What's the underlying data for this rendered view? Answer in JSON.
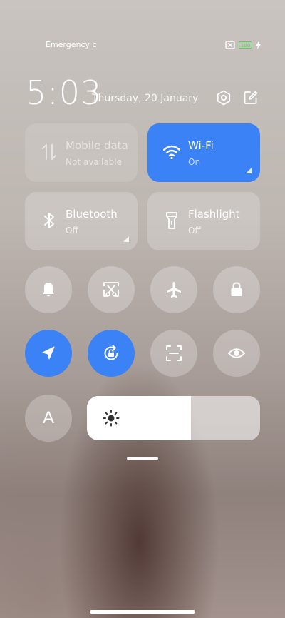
{
  "status_bar": {
    "carrier_text": "Emergency c",
    "battery_level": "100"
  },
  "header": {
    "time": "5:03",
    "date": "Thursday, 20 January"
  },
  "tiles": {
    "mobile_data": {
      "title": "Mobile data",
      "subtitle": "Not available"
    },
    "wifi": {
      "title": "Wi-Fi",
      "subtitle": "On"
    },
    "bluetooth": {
      "title": "Bluetooth",
      "subtitle": "Off"
    },
    "flashlight": {
      "title": "Flashlight",
      "subtitle": "Off"
    }
  },
  "toggles": [
    {
      "name": "notifications",
      "icon": "bell-icon",
      "on": false
    },
    {
      "name": "screenshot",
      "icon": "scissors-icon",
      "on": false
    },
    {
      "name": "airplane-mode",
      "icon": "airplane-icon",
      "on": false
    },
    {
      "name": "lock-screen",
      "icon": "lock-icon",
      "on": false
    },
    {
      "name": "location",
      "icon": "location-arrow-icon",
      "on": true
    },
    {
      "name": "auto-rotate-lock",
      "icon": "rotation-lock-icon",
      "on": true
    },
    {
      "name": "scanner",
      "icon": "scan-icon",
      "on": false
    },
    {
      "name": "reading-mode",
      "icon": "eye-icon",
      "on": false
    }
  ],
  "font_button": {
    "label": "A"
  },
  "brightness": {
    "level": 0.6
  },
  "colors": {
    "accent": "#3b82f6"
  }
}
